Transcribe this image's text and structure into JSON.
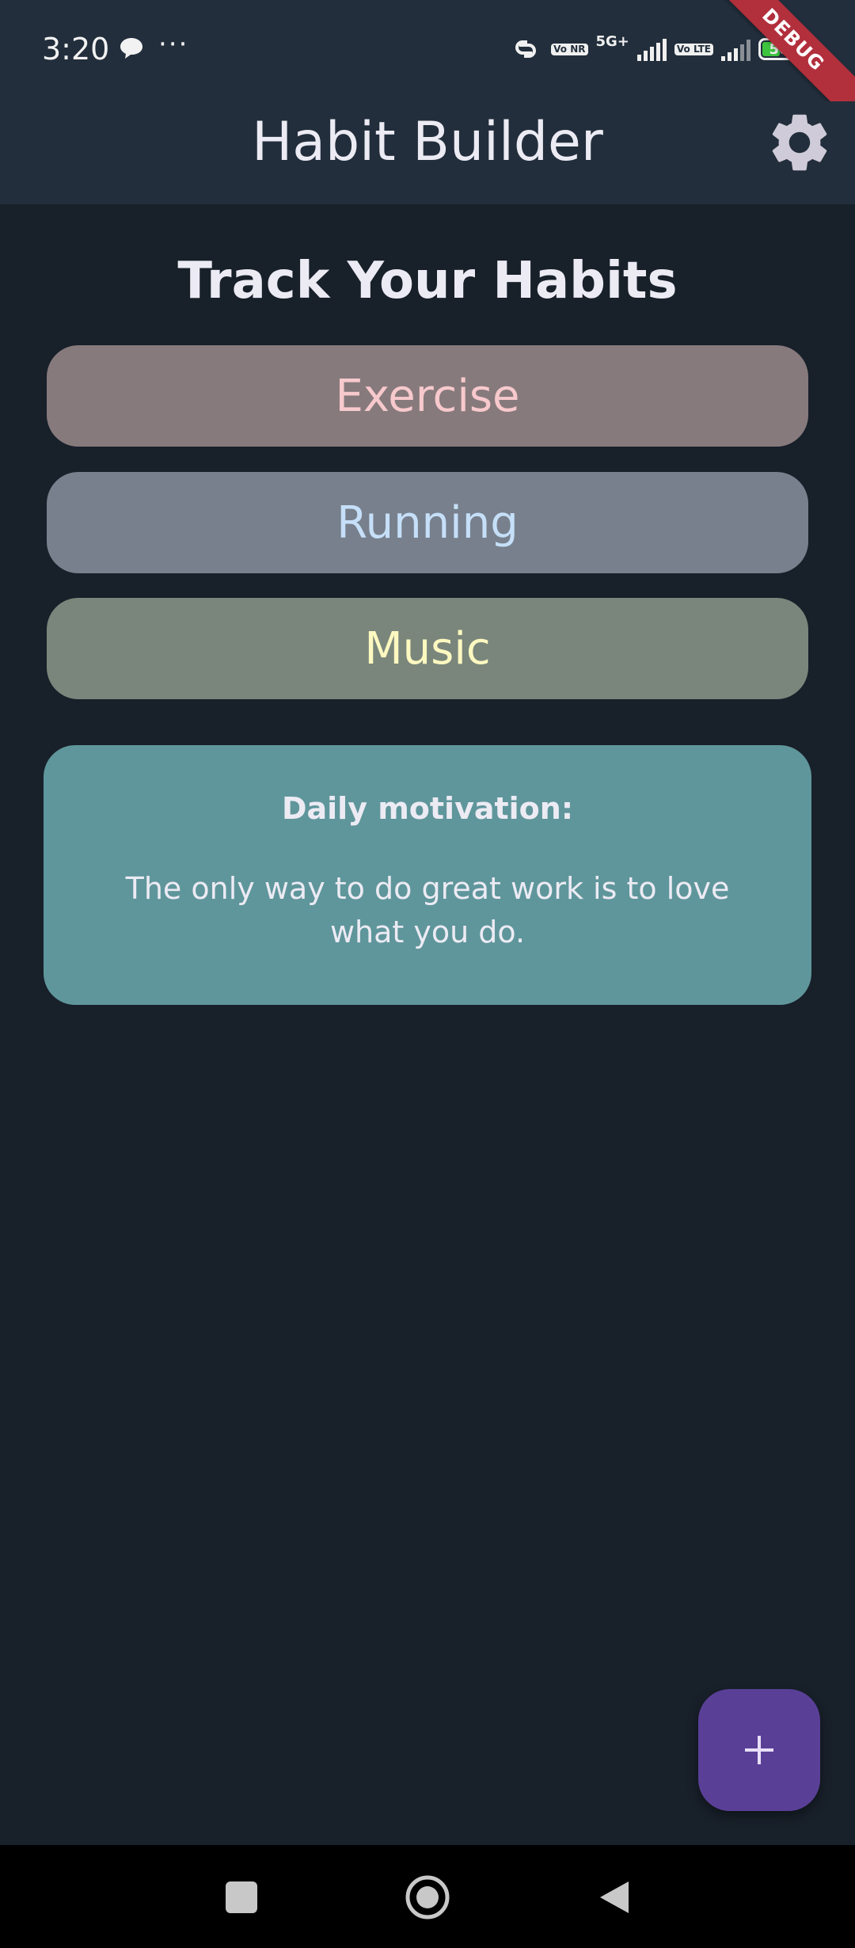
{
  "status_bar": {
    "time": "3:20",
    "dots": "···",
    "volte_1": "Vo NR",
    "network": "5G+",
    "volte_2": "Vo LTE",
    "battery": "50"
  },
  "debug_banner": "DEBUG",
  "app_bar": {
    "title": "Habit Builder",
    "settings_icon": "gear-icon"
  },
  "main": {
    "heading": "Track Your Habits",
    "habits": [
      {
        "label": "Exercise",
        "bg": "#877a7c",
        "fg": "#f7c9cd"
      },
      {
        "label": "Running",
        "bg": "#77808c",
        "fg": "#c6dff9"
      },
      {
        "label": "Music",
        "bg": "#7a867b",
        "fg": "#fcf8c0"
      }
    ],
    "motivation": {
      "label": "Daily motivation:",
      "quote": "The only way to do great work is to love what you do."
    }
  },
  "fab": {
    "icon": "plus-icon",
    "color": "#5a3f97"
  },
  "nav_bar": {
    "recents_icon": "square-icon",
    "home_icon": "circle-icon",
    "back_icon": "triangle-back-icon"
  }
}
